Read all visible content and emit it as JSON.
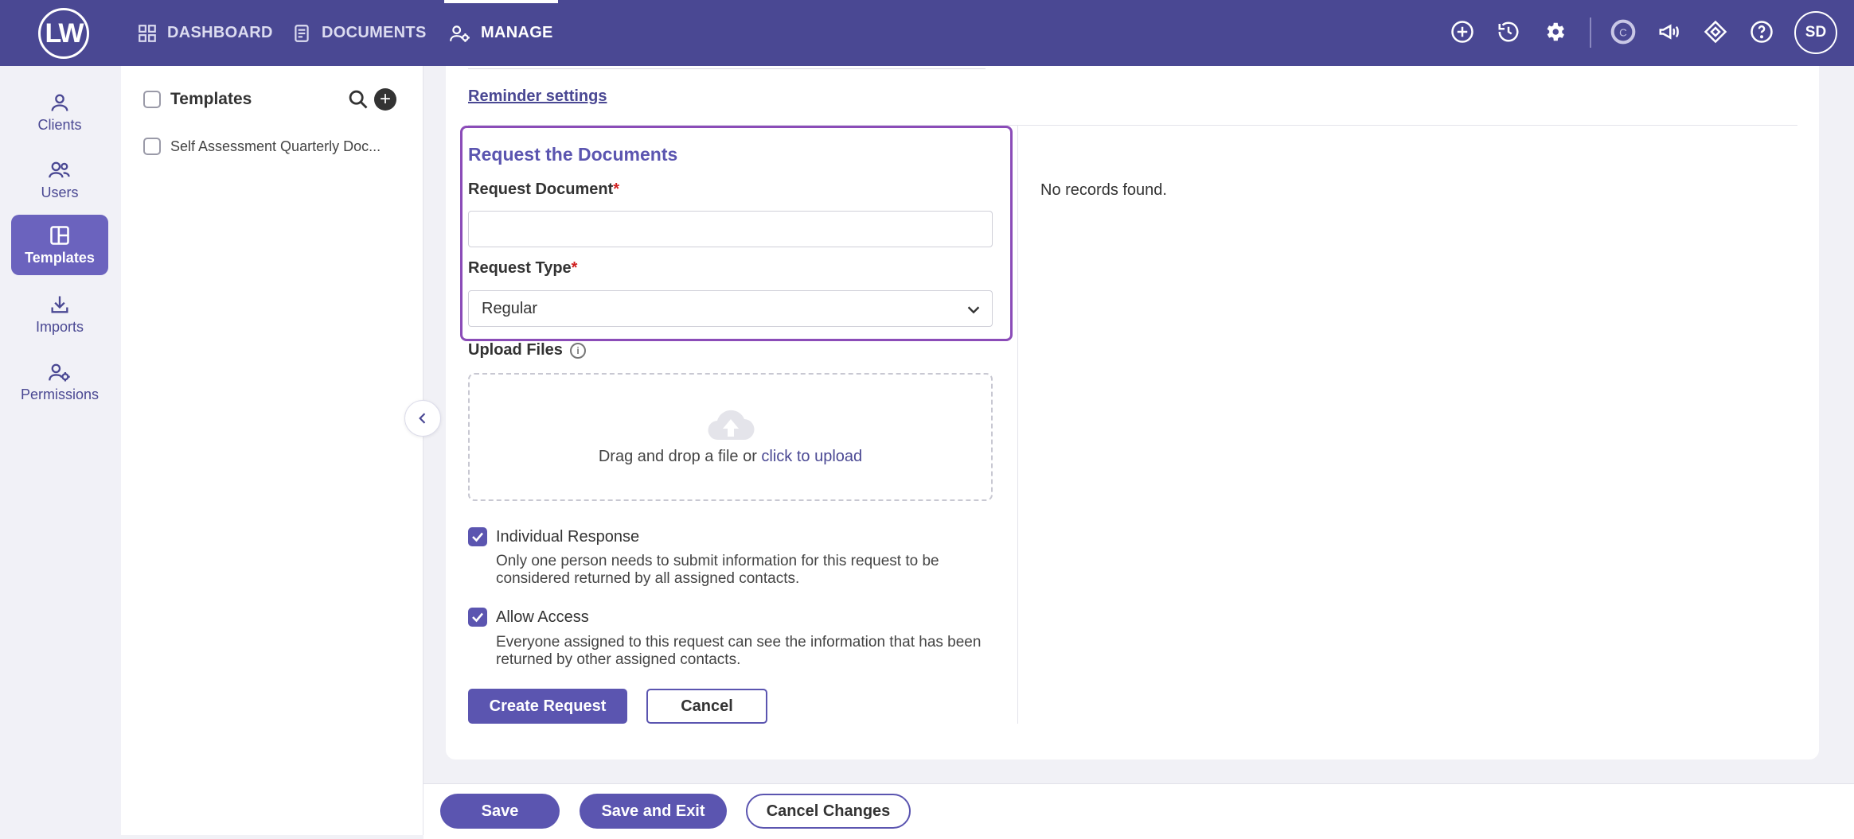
{
  "app": {
    "logo_text": "LW",
    "user_initials": "SD"
  },
  "nav": {
    "dashboard": "DASHBOARD",
    "documents": "DOCUMENTS",
    "manage": "MANAGE"
  },
  "rail": {
    "clients": "Clients",
    "users": "Users",
    "templates": "Templates",
    "imports": "Imports",
    "permissions": "Permissions"
  },
  "templates_panel": {
    "title": "Templates",
    "items": [
      {
        "label": "Self Assessment Quarterly Doc..."
      }
    ]
  },
  "form": {
    "reminder_link": "Reminder settings",
    "section_title": "Request the Documents",
    "request_document_label": "Request Document",
    "request_document_value": "",
    "required_mark": "*",
    "request_type_label": "Request Type",
    "request_type_value": "Regular",
    "upload_label": "Upload Files",
    "upload_text": "Drag and drop a file or ",
    "upload_link": "click to upload",
    "individual_response_label": "Individual Response",
    "individual_response_desc": "Only one person needs to submit information for this request to be considered returned by all assigned contacts.",
    "allow_access_label": "Allow Access",
    "allow_access_desc": "Everyone assigned to this request can see the information that has been returned by other assigned contacts.",
    "create_button": "Create Request",
    "cancel_button": "Cancel"
  },
  "records": {
    "empty_text": "No records found."
  },
  "footer": {
    "save": "Save",
    "save_exit": "Save and Exit",
    "cancel_changes": "Cancel Changes"
  },
  "colors": {
    "brand": "#4a4893",
    "accent": "#5b55b0",
    "highlight_border": "#8b4cb8"
  }
}
